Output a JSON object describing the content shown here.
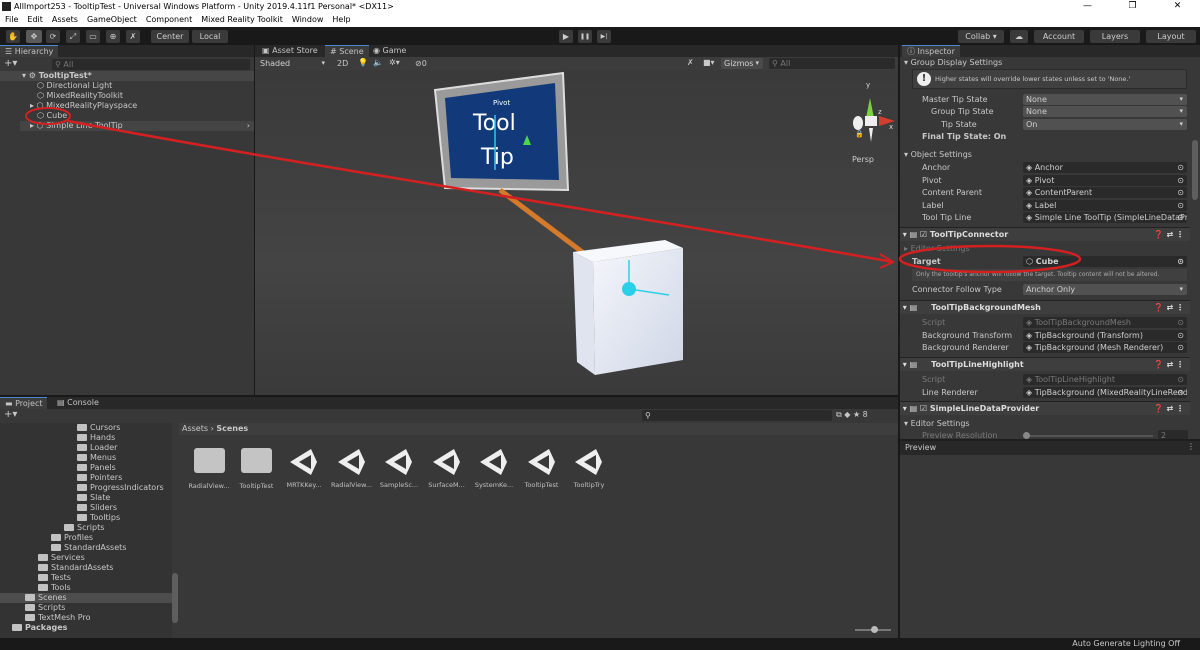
{
  "window": {
    "title": "AllImport253 - TooltipTest - Universal Windows Platform - Unity 2019.4.11f1 Personal* <DX11>",
    "controls": [
      "—",
      "❐",
      "✕"
    ]
  },
  "menu": [
    "File",
    "Edit",
    "Assets",
    "GameObject",
    "Component",
    "Mixed Reality Toolkit",
    "Window",
    "Help"
  ],
  "toolbar": {
    "tools": [
      "✋",
      "✥",
      "⟳",
      "⤢",
      "▭",
      "⊕",
      "✗"
    ],
    "center": "Center",
    "local": "Local",
    "play": "▶",
    "pause": "❚❚",
    "step": "▶|",
    "collab": "Collab ▾",
    "account": "Account",
    "layers": "Layers",
    "layout": "Layout"
  },
  "hierarchy": {
    "tab": "Hierarchy",
    "search_placeholder": "All",
    "scene": "TooltipTest*",
    "items": [
      "Directional Light",
      "MixedRealityToolkit",
      "MixedRealityPlayspace",
      "Cube",
      "Simple Line ToolTip"
    ]
  },
  "scene": {
    "tabs": [
      "Asset Store",
      "Scene",
      "Game"
    ],
    "shading": "Shaded",
    "mode2d": "2D",
    "hidden_count": "0",
    "gizmos": "Gizmos",
    "search_placeholder": "All",
    "persp": "Persp",
    "tooltip_text": [
      "Tool",
      "Tip"
    ],
    "pivot_label": "Pivot",
    "axes": [
      "y",
      "z",
      "x"
    ]
  },
  "inspector": {
    "tab": "Inspector",
    "group_display": {
      "title": "Group Display Settings",
      "info": "Higher states will override lower states unless set to 'None.'",
      "fields": [
        {
          "label": "Master Tip State",
          "value": "None"
        },
        {
          "label": "Group Tip State",
          "value": "None"
        },
        {
          "label": "Tip State",
          "value": "On"
        }
      ],
      "final": "Final Tip State: On"
    },
    "object_settings": {
      "title": "Object Settings",
      "fields": [
        {
          "label": "Anchor",
          "value": "Anchor"
        },
        {
          "label": "Pivot",
          "value": "Pivot"
        },
        {
          "label": "Content Parent",
          "value": "ContentParent"
        },
        {
          "label": "Label",
          "value": "Label"
        },
        {
          "label": "Tool Tip Line",
          "value": "Simple Line ToolTip (SimpleLineDataProv"
        }
      ]
    },
    "connector": {
      "title": "ToolTipConnector",
      "editor_settings": "Editor Settings",
      "target_label": "Target",
      "target_value": "Cube",
      "info": "Only the tooltip's anchor will follow the target. Tooltip content will not be altered.",
      "follow_label": "Connector Follow Type",
      "follow_value": "Anchor Only"
    },
    "bg_mesh": {
      "title": "ToolTipBackgroundMesh",
      "fields": [
        {
          "label": "Script",
          "value": "ToolTipBackgroundMesh"
        },
        {
          "label": "Background Transform",
          "value": "TipBackground (Transform)"
        },
        {
          "label": "Background Renderer",
          "value": "TipBackground (Mesh Renderer)"
        }
      ]
    },
    "line_highlight": {
      "title": "ToolTipLineHighlight",
      "fields": [
        {
          "label": "Script",
          "value": "ToolTipLineHighlight"
        },
        {
          "label": "Line Renderer",
          "value": "TipBackground (MixedRealityLineRender"
        }
      ]
    },
    "line_provider": {
      "title": "SimpleLineDataProvider",
      "editor_settings": "Editor Settings",
      "preview_label": "Preview Resolution",
      "preview_value": "2"
    },
    "preview": "Preview"
  },
  "project": {
    "tabs": [
      "Project",
      "Console"
    ],
    "badge": "8",
    "breadcrumb": [
      "Assets",
      "Scenes"
    ],
    "tree": [
      {
        "label": "Cursors",
        "depth": 4
      },
      {
        "label": "Hands",
        "depth": 4
      },
      {
        "label": "Loader",
        "depth": 4
      },
      {
        "label": "Menus",
        "depth": 4
      },
      {
        "label": "Panels",
        "depth": 4
      },
      {
        "label": "Pointers",
        "depth": 4
      },
      {
        "label": "ProgressIndicators",
        "depth": 4
      },
      {
        "label": "Slate",
        "depth": 4
      },
      {
        "label": "Sliders",
        "depth": 4
      },
      {
        "label": "Tooltips",
        "depth": 4
      },
      {
        "label": "Scripts",
        "depth": 3
      },
      {
        "label": "Profiles",
        "depth": 2
      },
      {
        "label": "StandardAssets",
        "depth": 2
      },
      {
        "label": "Services",
        "depth": 1
      },
      {
        "label": "StandardAssets",
        "depth": 1
      },
      {
        "label": "Tests",
        "depth": 1
      },
      {
        "label": "Tools",
        "depth": 1
      },
      {
        "label": "Scenes",
        "depth": 0
      },
      {
        "label": "Scripts",
        "depth": 0
      },
      {
        "label": "TextMesh Pro",
        "depth": 0
      },
      {
        "label": "Packages",
        "depth": -1
      }
    ],
    "assets": [
      {
        "name": "RadialView...",
        "type": "folder"
      },
      {
        "name": "TooltipTest",
        "type": "folder"
      },
      {
        "name": "MRTKKey...",
        "type": "scene"
      },
      {
        "name": "RadialView...",
        "type": "scene"
      },
      {
        "name": "SampleSc...",
        "type": "scene"
      },
      {
        "name": "SurfaceM...",
        "type": "scene"
      },
      {
        "name": "SystemKe...",
        "type": "scene"
      },
      {
        "name": "TooltipTest",
        "type": "scene"
      },
      {
        "name": "TooltipTry",
        "type": "scene"
      }
    ]
  },
  "status": "Auto Generate Lighting Off",
  "colors": {
    "annotation": "#d42020",
    "selection": "#4d4d4d",
    "accent": "#4a8ad4"
  }
}
